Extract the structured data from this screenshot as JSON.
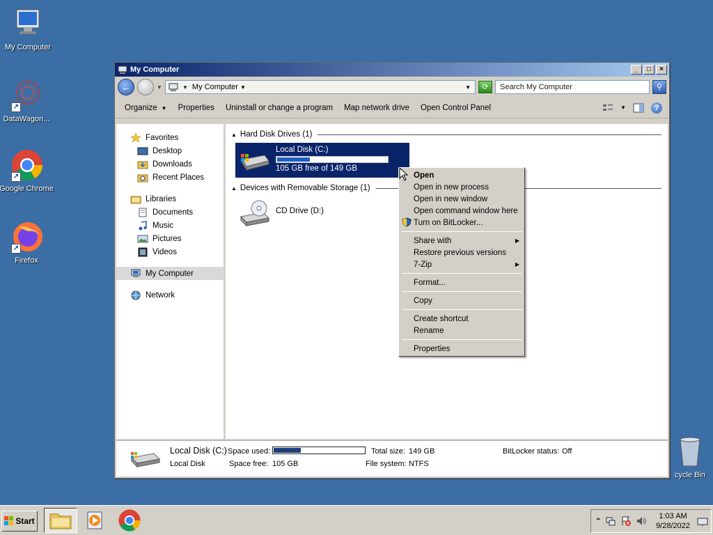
{
  "desktop": {
    "icons": [
      {
        "label": "My Computer"
      },
      {
        "label": "DataWagon..."
      },
      {
        "label": "Google Chrome"
      },
      {
        "label": "Firefox"
      }
    ],
    "recycle_label": "cycle Bin"
  },
  "window": {
    "title": "My Computer",
    "address": "My Computer",
    "search_placeholder": "Search My Computer",
    "toolbar": {
      "organize": "Organize",
      "properties": "Properties",
      "uninstall": "Uninstall or change a program",
      "map_drive": "Map network drive",
      "control_panel": "Open Control Panel"
    },
    "nav": {
      "favorites": "Favorites",
      "desktop": "Desktop",
      "downloads": "Downloads",
      "recent": "Recent Places",
      "libraries": "Libraries",
      "documents": "Documents",
      "music": "Music",
      "pictures": "Pictures",
      "videos": "Videos",
      "computer": "My Computer",
      "network": "Network"
    },
    "groups": {
      "hdd": "Hard Disk Drives (1)",
      "removable": "Devices with Removable Storage (1)"
    },
    "drives": {
      "c_name": "Local Disk (C:)",
      "c_free": "105 GB free of 149 GB",
      "c_used_fraction": 0.295,
      "d_name": "CD Drive (D:)"
    },
    "details": {
      "name": "Local Disk (C:)",
      "type": "Local Disk",
      "space_used_label": "Space used:",
      "space_used_fraction": 0.295,
      "space_free_label": "Space free:",
      "space_free_value": "105 GB",
      "total_size_label": "Total size:",
      "total_size_value": "149 GB",
      "filesystem_label": "File system:",
      "filesystem_value": "NTFS",
      "bitlocker_label": "BitLocker status:",
      "bitlocker_value": "Off"
    }
  },
  "context_menu": {
    "open": "Open",
    "open_process": "Open in new process",
    "open_window": "Open in new window",
    "open_cmd": "Open command window here",
    "bitlocker": "Turn on BitLocker...",
    "share": "Share with",
    "restore": "Restore previous versions",
    "zip": "7-Zip",
    "format": "Format...",
    "copy": "Copy",
    "shortcut": "Create shortcut",
    "rename": "Rename",
    "properties": "Properties"
  },
  "taskbar": {
    "start": "Start",
    "time": "1:03 AM",
    "date": "9/28/2022"
  }
}
